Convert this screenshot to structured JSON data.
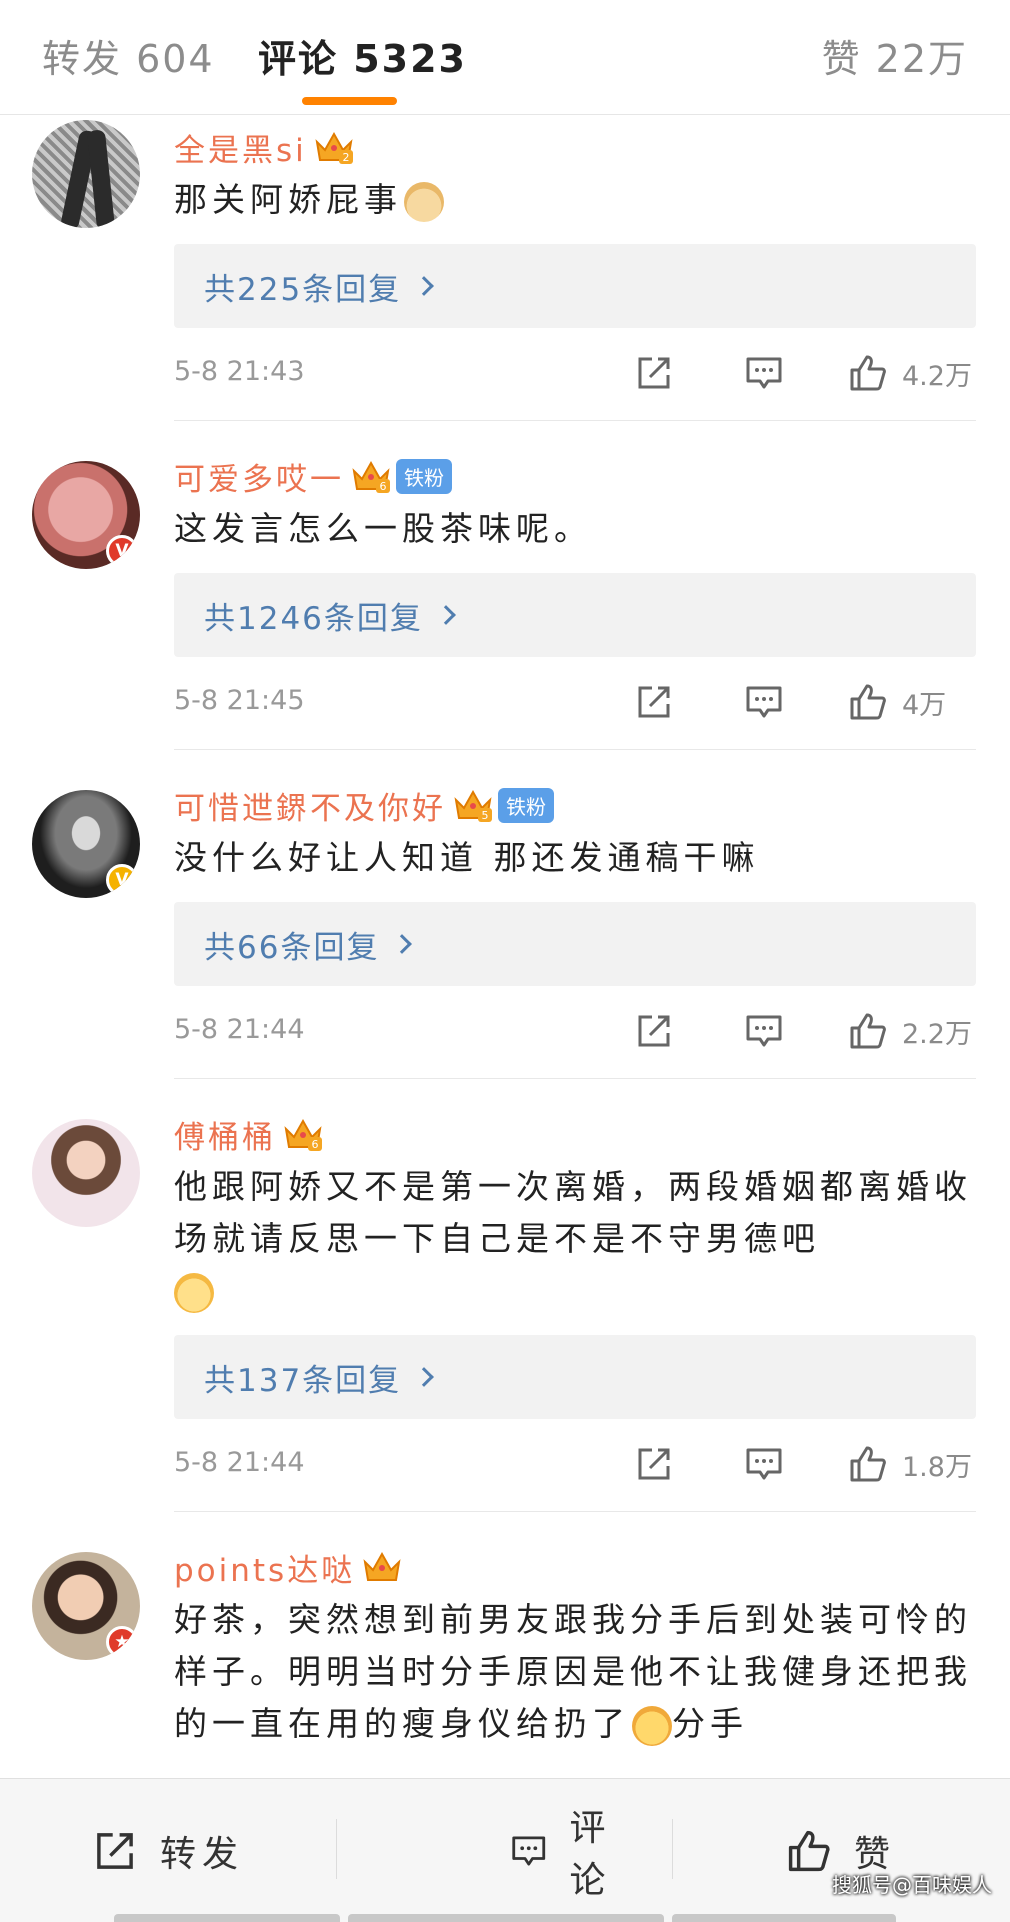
{
  "tabs": {
    "reposts": "转发 604",
    "comments": "评论 5323",
    "likes": "赞 22万"
  },
  "colors": {
    "accent": "#ff8200",
    "username": "#eb7350",
    "reply_link": "#507daf",
    "fan_tag": "#5b9fe8"
  },
  "comments": [
    {
      "user": "全是黑si",
      "crown_level": "2",
      "text": "那关阿娇屁事",
      "emoji": "doge",
      "replies": "共225条回复",
      "time": "5-8 21:43",
      "likes": "4.2万"
    },
    {
      "user": "可爱多哎一",
      "crown_level": "6",
      "fan_tag": "铁粉",
      "badge": "V",
      "text": "这发言怎么一股茶味呢。",
      "replies": "共1246条回复",
      "time": "5-8 21:45",
      "likes": "4万"
    },
    {
      "user": "可惜迣鎅不及你好",
      "crown_level": "5",
      "fan_tag": "铁粉",
      "badge": "V",
      "text": "没什么好让人知道 那还发通稿干嘛",
      "replies": "共66条回复",
      "time": "5-8 21:44",
      "likes": "2.2万"
    },
    {
      "user": "傅桶桶",
      "crown_level": "6",
      "text": "他跟阿娇又不是第一次离婚，两段婚姻都离婚收场就请反思一下自己是不是不守男德吧",
      "emoji": "shy",
      "replies": "共137条回复",
      "time": "5-8 21:44",
      "likes": "1.8万"
    },
    {
      "user": "points达哒",
      "crown_level": "",
      "badge": "★",
      "text": "好茶，突然想到前男友跟我分手后到处装可怜的样子。明明当时分手原因是他不让我健身还把我的一直在用的瘦身仪给扔了",
      "text_tail": "分手"
    }
  ],
  "bottom": {
    "repost": "转发",
    "comment": "评论",
    "like": "赞"
  },
  "watermark": "搜狐号@百味娱人"
}
